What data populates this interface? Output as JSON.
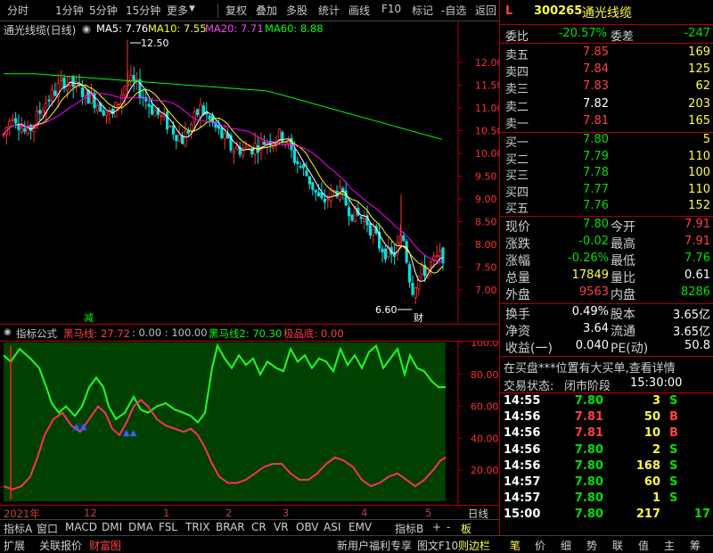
{
  "toolbar": {
    "items": [
      "分时",
      "1分钟",
      "5分钟",
      "15分钟",
      "更多",
      "复权",
      "叠加",
      "多股",
      "统计",
      "画线",
      "F10",
      "标记",
      "-自选",
      "返回"
    ]
  },
  "chart": {
    "title": "通光线缆(日线)",
    "ma5": "MA5: 7.76",
    "ma10": "MA10: 7.55",
    "ma20": "MA20: 7.71",
    "ma60": "MA60: 8.88",
    "colors": {
      "ma5": "#ffffff",
      "ma10": "#ffff00",
      "ma20": "#ff00ff",
      "ma60": "#00ff00",
      "up": "#ff3030",
      "down": "#00e0e0"
    },
    "high_label": "12.50",
    "low_label": "6.60",
    "marker_jian": "减",
    "marker_cai": "财"
  },
  "chart_data": [
    {
      "type": "candlestick",
      "title": "通光线缆(日线)",
      "y_ticks": [
        7.0,
        7.5,
        8.0,
        8.5,
        9.0,
        9.5,
        10.0,
        10.5,
        11.0,
        11.5,
        12.0
      ],
      "ylim": [
        6.5,
        12.5
      ],
      "x_ticks": [
        "2021年",
        "12",
        "1",
        "2",
        "3",
        "4",
        "5"
      ],
      "series": [
        {
          "name": "MA5",
          "value": 7.76
        },
        {
          "name": "MA10",
          "value": 7.55
        },
        {
          "name": "MA20",
          "value": 7.71
        },
        {
          "name": "MA60",
          "value": 8.88
        }
      ],
      "high": 12.5,
      "low": 6.6
    },
    {
      "type": "line",
      "title": "指标公式",
      "y_ticks": [
        20.0,
        40.0,
        60.0,
        80.0,
        100.0
      ],
      "ylim": [
        0,
        100
      ],
      "series": [
        {
          "name": "黑马线",
          "value": 27.72
        },
        {
          "name": "黑马线2",
          "value": 70.3
        },
        {
          "name": "极品底",
          "value": 0.0
        }
      ]
    }
  ],
  "indicator": {
    "name": "指标公式",
    "hm1": "黑马线: 27.72",
    "params": ": 0.00 : 100.00",
    "hm2": "黑马线2: 70.30",
    "jpd": "极品底: 0.00"
  },
  "date_axis": {
    "year": "2021年",
    "m12": "12",
    "m1": "1",
    "m2": "2",
    "m3": "3",
    "m4": "4",
    "m5": "5",
    "right": "日线"
  },
  "tabs": [
    "指标A",
    "窗口",
    "MACD",
    "DMI",
    "DMA",
    "FSL",
    "TRIX",
    "BRAR",
    "CR",
    "VR",
    "OBV",
    "ASI",
    "EMV"
  ],
  "tabs_right": [
    "指标B",
    "+",
    "-",
    "板"
  ],
  "status": {
    "expand": "扩展",
    "related": "关联报价",
    "wealth": "财富图",
    "welfare": "新用户福利专享",
    "f10": "图文F10",
    "sidebar": "则边栏",
    "icons": [
      "笔",
      "价",
      "细",
      "势",
      "联",
      "值",
      "主",
      "筹"
    ]
  },
  "quote": {
    "flag": "L",
    "code": "300265",
    "name": "通光线缆",
    "weibi_label": "委比",
    "weibi": "-20.57%",
    "weicha_label": "委差",
    "weicha": "-247",
    "asks": [
      {
        "label": "卖五",
        "price": "7.85",
        "vol": "169"
      },
      {
        "label": "卖四",
        "price": "7.84",
        "vol": "125"
      },
      {
        "label": "卖三",
        "price": "7.83",
        "vol": "62"
      },
      {
        "label": "卖二",
        "price": "7.82",
        "vol": "203"
      },
      {
        "label": "卖一",
        "price": "7.81",
        "vol": "165"
      }
    ],
    "bids": [
      {
        "label": "买一",
        "price": "7.80",
        "vol": "5"
      },
      {
        "label": "买二",
        "price": "7.79",
        "vol": "110"
      },
      {
        "label": "买三",
        "price": "7.78",
        "vol": "100"
      },
      {
        "label": "买四",
        "price": "7.77",
        "vol": "110"
      },
      {
        "label": "买五",
        "price": "7.76",
        "vol": "152"
      }
    ],
    "stats": [
      {
        "l1": "现价",
        "v1": "7.80",
        "l2": "今开",
        "v2": "7.91"
      },
      {
        "l1": "涨跌",
        "v1": "-0.02",
        "l2": "最高",
        "v2": "7.91"
      },
      {
        "l1": "涨幅",
        "v1": "-0.26%",
        "l2": "最低",
        "v2": "7.76"
      },
      {
        "l1": "总量",
        "v1": "17849",
        "l2": "量比",
        "v2": "0.61"
      },
      {
        "l1": "外盘",
        "v1": "9563",
        "l2": "内盘",
        "v2": "8286"
      }
    ],
    "stats2": [
      {
        "l1": "换手",
        "v1": "0.49%",
        "l2": "股本",
        "v2": "3.65亿"
      },
      {
        "l1": "净资",
        "v1": "3.64",
        "l2": "流通",
        "v2": "3.65亿"
      },
      {
        "l1": "收益(一)",
        "v1": "0.040",
        "l2": "PE(动)",
        "v2": "50.8"
      }
    ],
    "notice": "在买盘***位置有大买单,查看详情",
    "trade_state_label": "交易状态:",
    "trade_state": "闭市阶段",
    "trade_time": "15:30:00",
    "ticks": [
      {
        "time": "14:55",
        "price": "7.80",
        "vol": "3",
        "side": "S"
      },
      {
        "time": "14:56",
        "price": "7.81",
        "vol": "50",
        "side": "B"
      },
      {
        "time": "14:56",
        "price": "7.81",
        "vol": "10",
        "side": "B"
      },
      {
        "time": "14:56",
        "price": "7.80",
        "vol": "2",
        "side": "S"
      },
      {
        "time": "14:56",
        "price": "7.80",
        "vol": "168",
        "side": "S"
      },
      {
        "time": "14:57",
        "price": "7.80",
        "vol": "60",
        "side": "S"
      },
      {
        "time": "14:57",
        "price": "7.80",
        "vol": "1",
        "side": "S"
      },
      {
        "time": "15:00",
        "price": "7.80",
        "vol": "217",
        "side": "",
        "count": "17"
      }
    ]
  }
}
